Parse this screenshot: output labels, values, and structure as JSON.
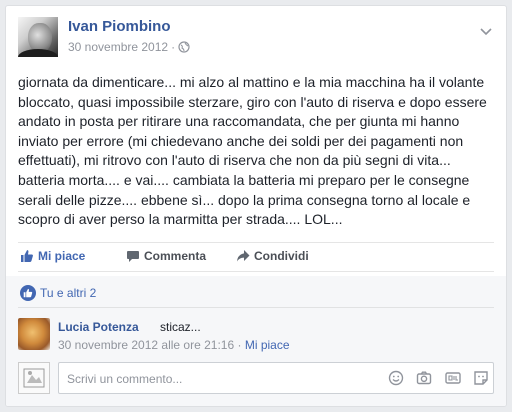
{
  "post": {
    "author": "Ivan Piombino",
    "date": "30 novembre 2012",
    "separator": "·",
    "text": "giornata da dimenticare... mi alzo al mattino e la mia macchina ha il volante bloccato, quasi impossibile sterzare, giro con l'auto di riserva e dopo essere andato in posta per ritirare una raccomandata, che per giunta mi hanno inviato per errore (mi chiedevano anche dei soldi per dei pagamenti non effettuati), mi ritrovo con l'auto di riserva che non da più segni di vita... batteria morta.... e vai.... cambiata la batteria mi preparo per le consegne serali delle pizze.... ebbene sì... dopo la prima consegna torno al locale e scopro di aver perso la marmitta per strada.... LOL..."
  },
  "actions": {
    "like": "Mi piace",
    "comment": "Commenta",
    "share": "Condividi"
  },
  "reactions": {
    "summary": "Tu e altri 2"
  },
  "comment": {
    "author": "Lucia Potenza",
    "text": "sticaz...",
    "timestamp": "30 novembre 2012 alle ore 21:16",
    "separator": "·",
    "like_link": "Mi piace"
  },
  "composer": {
    "placeholder": "Scrivi un commento..."
  },
  "colors": {
    "accent": "#4267b2",
    "link": "#365899",
    "muted": "#90949c",
    "background": "#e9ebee"
  },
  "icons": {
    "privacy": "globe-icon",
    "menu": "chevron-down-icon",
    "like": "thumbs-up-icon",
    "comment": "speech-bubble-icon",
    "share": "share-arrow-icon",
    "composer_tools": [
      "emoji-icon",
      "camera-icon",
      "gif-icon",
      "sticker-icon"
    ]
  }
}
